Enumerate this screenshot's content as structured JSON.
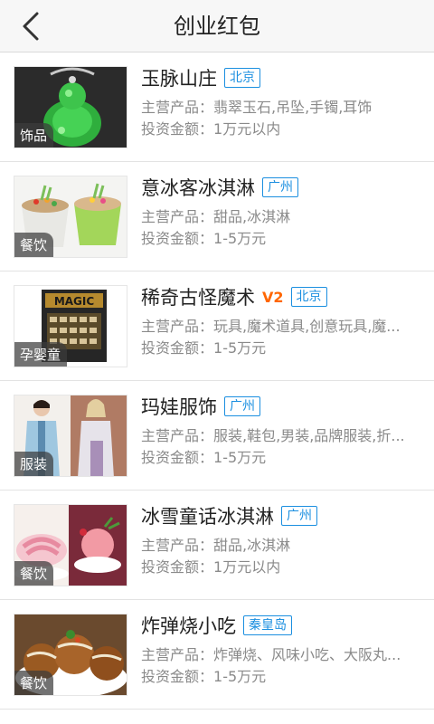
{
  "header": {
    "title": "创业红包"
  },
  "labels": {
    "main_products": "主营产品：",
    "investment": "投资金额："
  },
  "items": [
    {
      "name": "玉脉山庄",
      "badge": "",
      "city": "北京",
      "category": "饰品",
      "products": "翡翠玉石,吊坠,手镯,耳饰",
      "investment": "1万元以内"
    },
    {
      "name": "意冰客冰淇淋",
      "badge": "",
      "city": "广州",
      "category": "餐饮",
      "products": "甜品,冰淇淋",
      "investment": "1-5万元"
    },
    {
      "name": "稀奇古怪魔术",
      "badge": "V2",
      "city": "北京",
      "category": "孕婴童",
      "products": "玩具,魔术道具,创意玩具,魔...",
      "investment": "1-5万元"
    },
    {
      "name": "玛娃服饰",
      "badge": "",
      "city": "广州",
      "category": "服装",
      "products": "服装,鞋包,男装,品牌服装,折...",
      "investment": "1-5万元"
    },
    {
      "name": "冰雪童话冰淇淋",
      "badge": "",
      "city": "广州",
      "category": "餐饮",
      "products": "甜品,冰淇淋",
      "investment": "1万元以内"
    },
    {
      "name": "炸弹烧小吃",
      "badge": "",
      "city": "秦皇岛",
      "category": "餐饮",
      "products": "炸弹烧、风味小吃、大阪丸...",
      "investment": "1-5万元"
    }
  ],
  "images": {
    "magic_box_text": "MAGIC"
  }
}
